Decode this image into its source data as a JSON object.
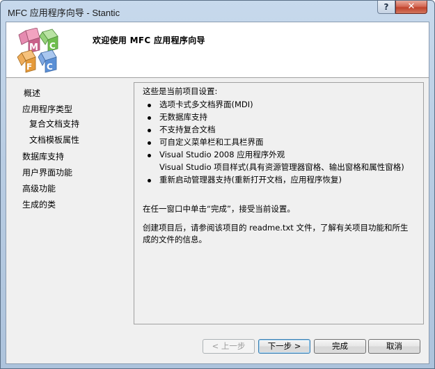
{
  "window": {
    "title": "MFC 应用程序向导 - Stantic",
    "help_label": "?",
    "close_label": "✕"
  },
  "header": {
    "title": "欢迎使用 MFC 应用程序向导",
    "logo_letters": [
      "M",
      "F",
      "C"
    ]
  },
  "nav": {
    "items": [
      {
        "label": "概述"
      },
      {
        "label": "应用程序类型"
      },
      {
        "label": "复合文档支持"
      },
      {
        "label": "文档模板属性"
      },
      {
        "label": "数据库支持"
      },
      {
        "label": "用户界面功能"
      },
      {
        "label": "高级功能"
      },
      {
        "label": "生成的类"
      }
    ]
  },
  "content": {
    "intro": "这些是当前项目设置:",
    "bullets": [
      "选项卡式多文档界面(MDI)",
      "无数据库支持",
      "不支持复合文档",
      "可自定义菜单栏和工具栏界面",
      "Visual Studio 2008 应用程序外观",
      "Visual Studio 项目样式(具有资源管理器窗格、输出窗格和属性窗格)",
      "重新启动管理器支持(重新打开文档，应用程序恢复)"
    ],
    "para1": "在任一窗口中单击“完成”，接受当前设置。",
    "para2": "创建项目后，请参阅该项目的 readme.txt 文件，了解有关项目功能和所生成的文件的信息。"
  },
  "buttons": {
    "prev": "< 上一步",
    "next": "下一步 >",
    "finish": "完成",
    "cancel": "取消"
  }
}
